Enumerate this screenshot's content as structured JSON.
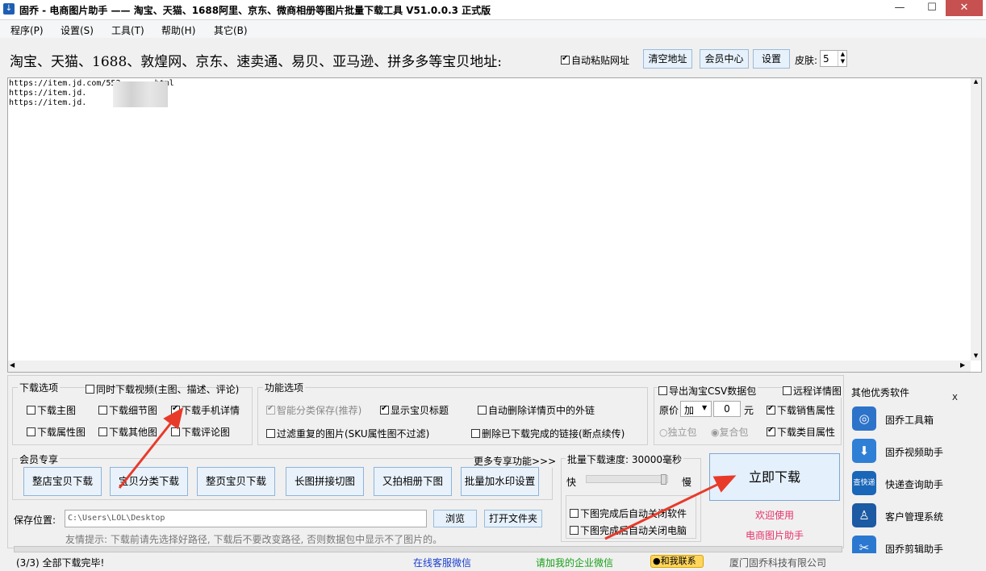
{
  "window": {
    "title": "固乔 - 电商图片助手 —— 淘宝、天猫、1688阿里、京东、微商相册等图片批量下载工具 V51.0.0.3 正式版",
    "minimize": "—",
    "maximize": "☐",
    "close": "✕"
  },
  "menu": [
    "程序(P)",
    "设置(S)",
    "工具(T)",
    "帮助(H)",
    "其它(B)"
  ],
  "address_bar": {
    "label": "淘宝、天猫、1688、敦煌网、京东、速卖通、易贝、亚马逊、拼多多等宝贝地址:",
    "auto_paste": "自动粘贴网址",
    "clear": "清空地址",
    "member": "会员中心",
    "settings": "设置",
    "skin_label": "皮肤:",
    "skin_value": "5"
  },
  "urls": "https://item.jd.com/552      .html\nhttps://item.jd.\nhttps://item.jd.",
  "download_options": {
    "title": "下载选项",
    "video": "同时下载视频(主图、描述、评论)",
    "items": [
      "下载主图",
      "下载细节图",
      "下载手机详情",
      "下载属性图",
      "下载其他图",
      "下载评论图"
    ]
  },
  "function_options": {
    "title": "功能选项",
    "smart": "智能分类保存(推荐)",
    "show_title": "显示宝贝标题",
    "delete_links": "自动删除详情页中的外链",
    "filter": "过滤重复的图片(SKU属性图不过滤)",
    "delete_done": "删除已下载完成的链接(断点续传)"
  },
  "csv": {
    "export": "导出淘宝CSV数据包",
    "remote": "远程详情图",
    "price_label": "原价",
    "price_mode": "加",
    "price_value": "0",
    "unit": "元",
    "sales_attr": "下载销售属性",
    "solo": "独立包",
    "combo": "复合包",
    "category_attr": "下载类目属性"
  },
  "member": {
    "title": "会员专享",
    "more": "更多专享功能>>>",
    "buttons": [
      "整店宝贝下载",
      "宝贝分类下载",
      "整页宝贝下载",
      "长图拼接切图",
      "又拍相册下图",
      "批量加水印设置"
    ]
  },
  "speed": {
    "title": "批量下载速度: 30000毫秒",
    "fast": "快",
    "slow": "慢",
    "close_app": "下图完成后自动关闭软件",
    "close_pc": "下图完成后自动关闭电脑"
  },
  "download_now": "立即下载",
  "welcome": [
    "欢迎使用",
    "电商图片助手"
  ],
  "save": {
    "label": "保存位置:",
    "path": "C:\\Users\\LOL\\Desktop",
    "browse": "浏览",
    "open_folder": "打开文件夹",
    "tip": "友情提示: 下载前请先选择好路径, 下载后不要改变路径, 否则数据包中显示不了图片的。"
  },
  "side_panel": {
    "title": "其他优秀软件",
    "close": "X",
    "items": [
      "固乔工具箱",
      "固乔视频助手",
      "快递查询助手",
      "客户管理系统",
      "固乔剪辑助手"
    ],
    "icon_text": "查快递"
  },
  "status": {
    "message": "(3/3) 全部下载完毕!",
    "service": "在线客服微信",
    "wechat": "请加我的企业微信",
    "contact": "和我联系",
    "company": "厦门固乔科技有限公司"
  },
  "colors": {
    "accent": "#1f5fb3",
    "pink": "#e8326a",
    "green": "#18a018",
    "blue_link": "#1a3fd0",
    "arrow": "#e83a2a"
  }
}
